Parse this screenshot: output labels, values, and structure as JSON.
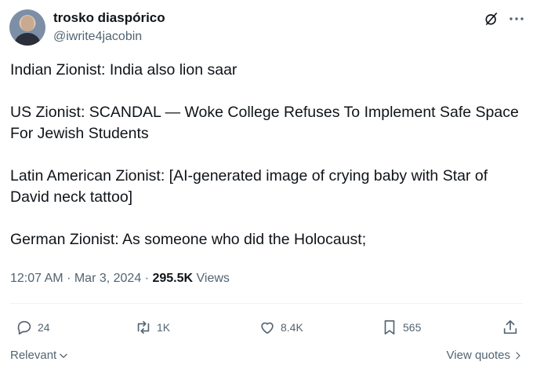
{
  "author": {
    "display_name": "trosko diaspórico",
    "handle": "@iwrite4jacobin"
  },
  "tweet": {
    "paragraphs": [
      "Indian Zionist: India also lion saar",
      "US Zionist: SCANDAL — Woke College Refuses To Implement Safe Space For Jewish Students",
      "Latin American Zionist: [AI-generated image of crying baby with Star of David neck tattoo]",
      "German Zionist: As someone who did the Holocaust;"
    ],
    "time": "12:07 AM",
    "date": "Mar 3, 2024",
    "views_count": "295.5K",
    "views_label": "Views",
    "separator": "·"
  },
  "actions": {
    "replies": "24",
    "reposts": "1K",
    "likes": "8.4K",
    "bookmarks": "565"
  },
  "footer": {
    "sort_label": "Relevant",
    "view_quotes_label": "View quotes"
  },
  "icons": {
    "grok": "grok-icon",
    "more": "more-dots-icon",
    "reply": "reply-icon",
    "repost": "repost-icon",
    "like": "heart-icon",
    "bookmark": "bookmark-icon",
    "share": "share-icon"
  },
  "colors": {
    "text": "#0f1419",
    "secondary": "#536471",
    "divider": "#eff3f4"
  }
}
